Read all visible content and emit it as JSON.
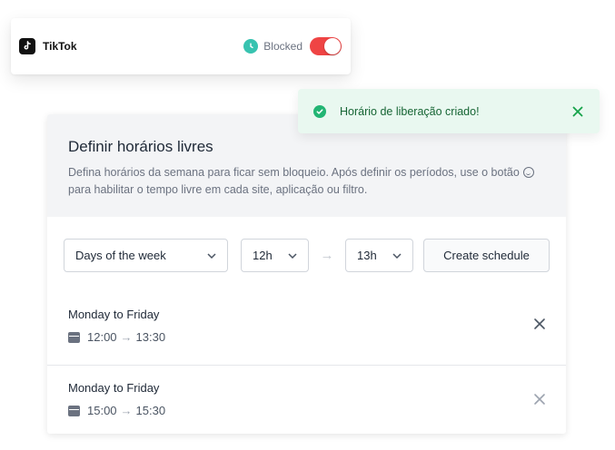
{
  "app_card": {
    "app_name": "TikTok",
    "icon": "tiktok-logo-icon",
    "status_icon": "clock-icon",
    "status_label": "Blocked",
    "toggle_on": true,
    "toggle_color": "#ef4444",
    "status_color": "#38c3b0"
  },
  "toast": {
    "message": "Horário de liberação criado!",
    "icon": "check-circle-icon",
    "close_icon": "close-icon",
    "background": "#e9f8f0",
    "accent": "#22b573"
  },
  "panel": {
    "title": "Definir horários livres",
    "desc_part1": "Defina horários da semana para ficar sem bloqueio. Após definir os períodos, use o botão",
    "desc_part2": "para habilitar o tempo livre em cada site, aplicação ou filtro.",
    "desc_icon": "smile-icon"
  },
  "controls": {
    "days_select": "Days of the week",
    "from_select": "12h",
    "to_select": "13h",
    "arrow": "→",
    "create_button": "Create schedule"
  },
  "schedules": [
    {
      "title": "Monday to Friday",
      "start": "12:00",
      "end": "13:30"
    },
    {
      "title": "Monday to Friday",
      "start": "15:00",
      "end": "15:30"
    }
  ]
}
